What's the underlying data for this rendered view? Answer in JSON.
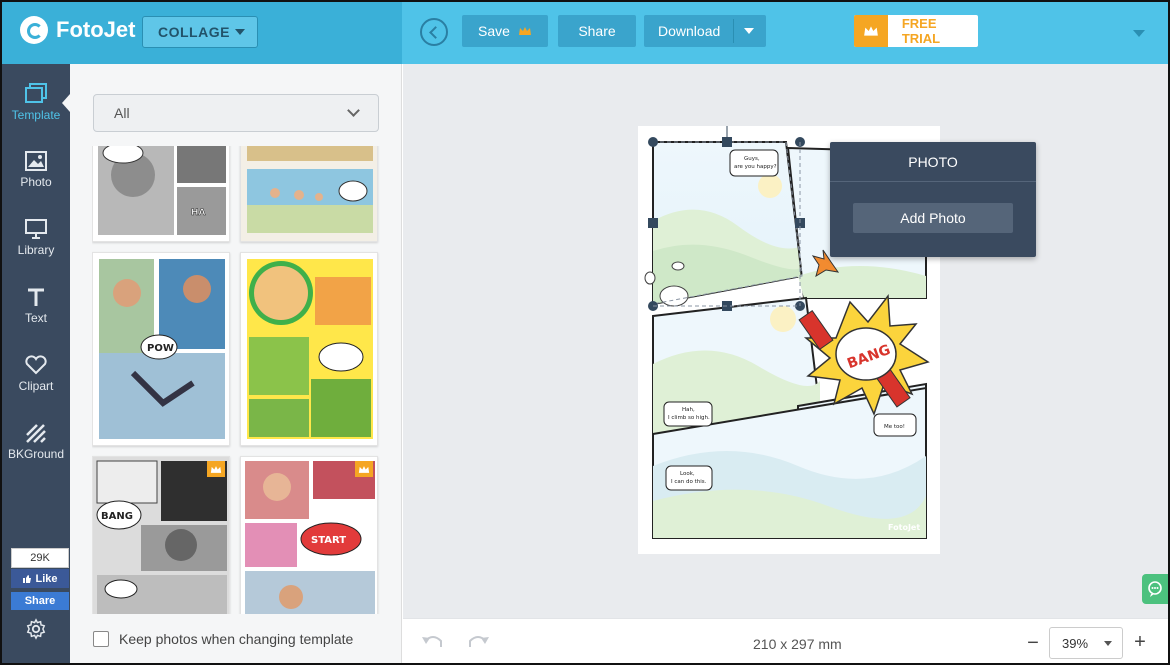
{
  "app": {
    "name": "FotoJet",
    "mode_select": "COLLAGE"
  },
  "toolbar": {
    "save_label": "Save",
    "share_label": "Share",
    "download_label": "Download",
    "trial_label": "FREE TRIAL"
  },
  "sidebar": {
    "items": [
      {
        "label": "Template",
        "icon": "template-icon",
        "active": true
      },
      {
        "label": "Photo",
        "icon": "photo-icon"
      },
      {
        "label": "Library",
        "icon": "library-icon"
      },
      {
        "label": "Text",
        "icon": "text-icon"
      },
      {
        "label": "Clipart",
        "icon": "clipart-icon"
      },
      {
        "label": "BKGround",
        "icon": "background-icon"
      }
    ],
    "fb_count": "29K",
    "fb_like": "Like",
    "fb_share": "Share"
  },
  "panel": {
    "filter_value": "All",
    "keep_photos_label": "Keep photos when changing template"
  },
  "canvas": {
    "bubbles": {
      "happy": "Guys,\nare you happy?",
      "climb": "Hah,\nI climb so high.",
      "metoo": "Me too!",
      "cando": "Look,\nI can do this."
    },
    "bang_text": "BANG",
    "watermark": "FotoJet"
  },
  "photo_popup": {
    "title": "PHOTO",
    "add_button": "Add Photo"
  },
  "bottom": {
    "page_size": "210 x 297 mm",
    "zoom": "39%"
  },
  "colors": {
    "topbar": "#4fc3e8",
    "sidenav": "#3a4a5f",
    "accent": "#f5a623"
  }
}
